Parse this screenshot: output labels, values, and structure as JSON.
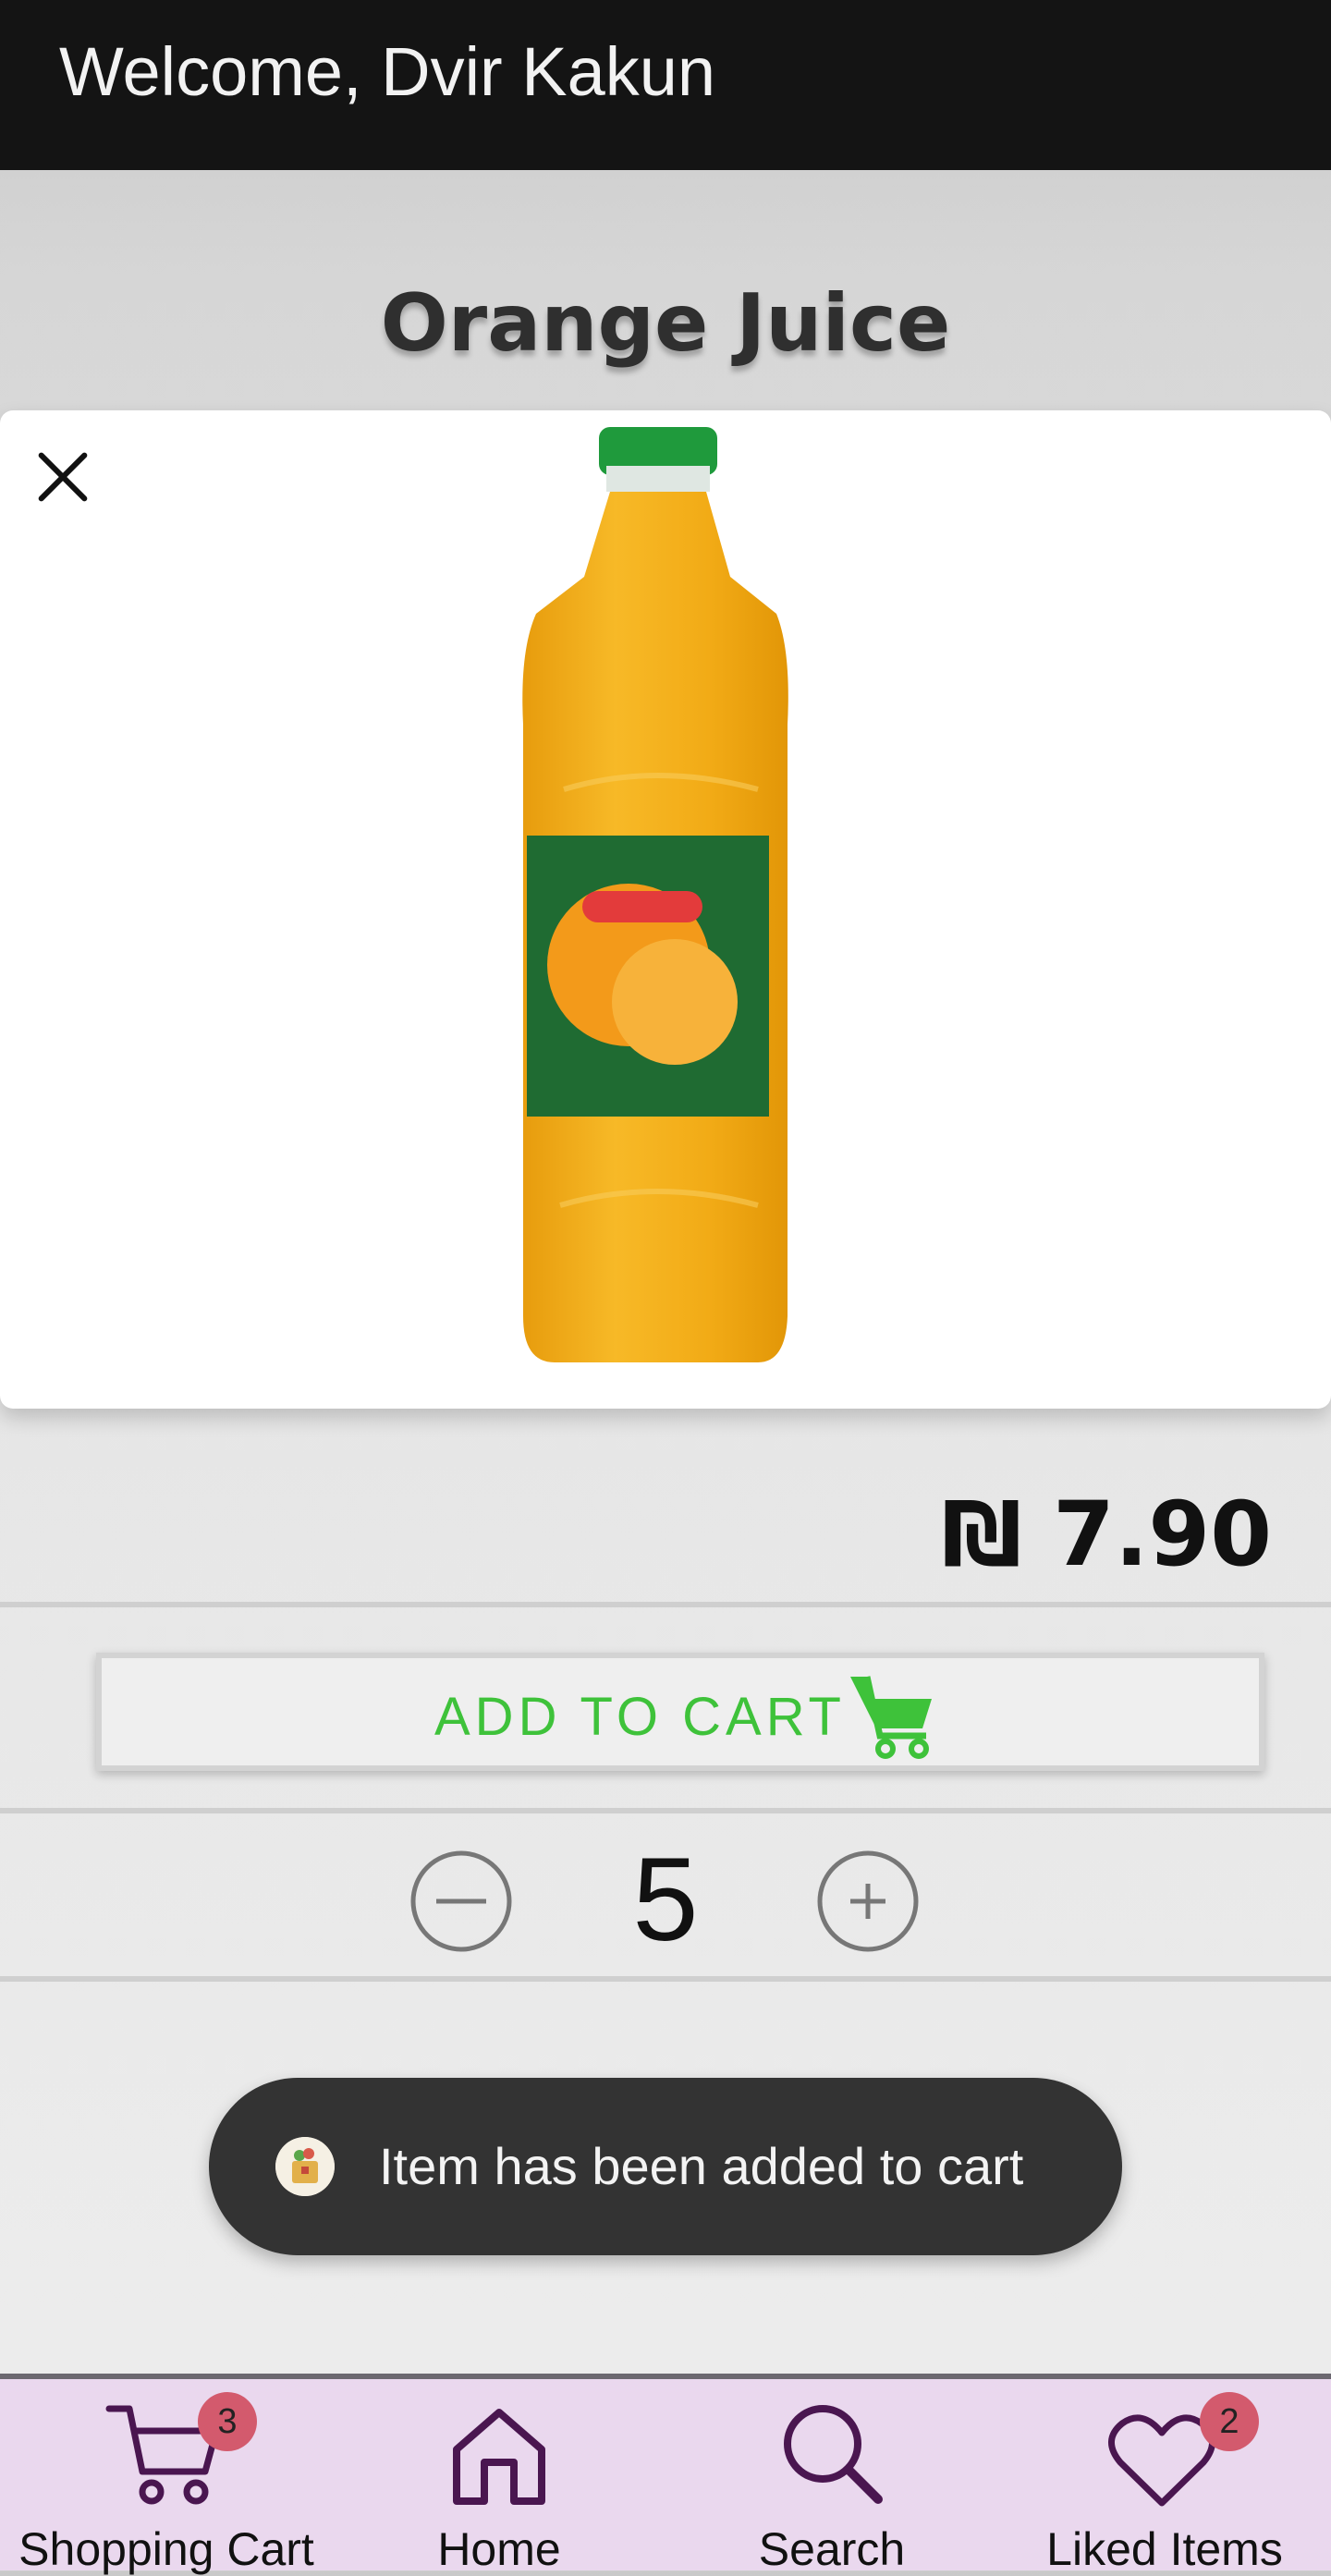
{
  "header": {
    "welcome": "Welcome, Dvir Kakun"
  },
  "product": {
    "name": "Orange Juice",
    "price": "₪ 7.90"
  },
  "actions": {
    "add_to_cart_label": "ADD TO CART"
  },
  "quantity": {
    "value": "5"
  },
  "toast": {
    "message": "Item has been added to cart"
  },
  "nav": {
    "items": [
      {
        "label": "Shopping Cart",
        "icon": "cart-icon",
        "badge": "3"
      },
      {
        "label": "Home",
        "icon": "home-icon"
      },
      {
        "label": "Search",
        "icon": "search-icon"
      },
      {
        "label": "Liked Items",
        "icon": "heart-icon",
        "badge": "2"
      }
    ]
  },
  "colors": {
    "accent_green": "#3ec23a",
    "nav_bg": "#ead8ee",
    "badge": "#d35a6d",
    "nav_icon": "#4a1650"
  }
}
